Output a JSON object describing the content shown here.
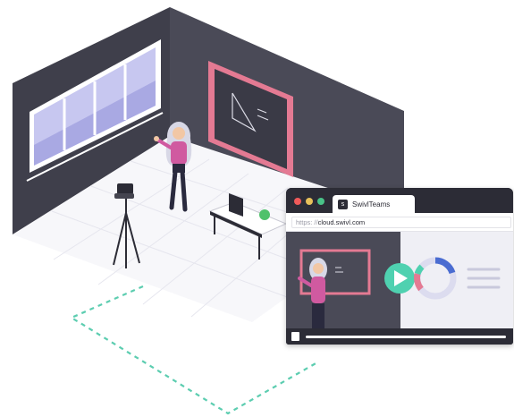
{
  "browser": {
    "tab_label": "SwivlTeams",
    "tab_logo": "s",
    "url_scheme": "https: //",
    "url_host": "cloud.swivl.com"
  },
  "icons": {
    "play": "play-icon",
    "donut": "donut-chart-icon",
    "logo": "swivl-logo-icon"
  },
  "colors": {
    "dark": "#2c2c36",
    "wall_left": "#3f3f4b",
    "wall_right": "#4a4a57",
    "accent_pink": "#e47a93",
    "accent_teal": "#4fd1b0",
    "window_lilac": "#c7c7f0",
    "dash_teal": "#5ccdb0"
  }
}
